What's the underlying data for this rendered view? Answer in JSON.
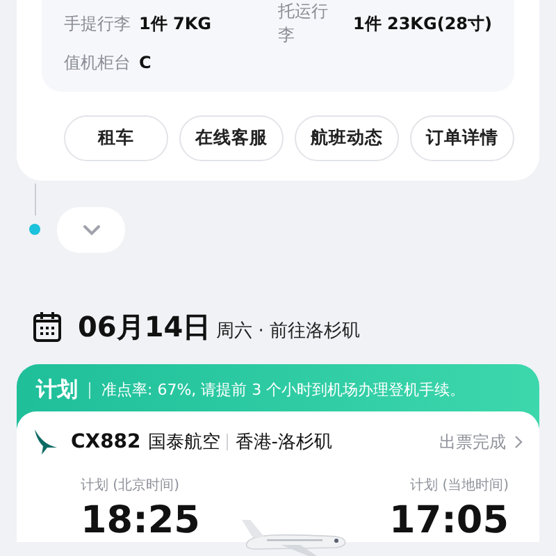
{
  "baggage": {
    "items": [
      {
        "label": "手提行李",
        "value": "1件 7KG"
      },
      {
        "label": "托运行李",
        "value": "1件 23KG(28寸)"
      },
      {
        "label": "值机柜台",
        "value": "C"
      }
    ]
  },
  "actions": [
    "租车",
    "在线客服",
    "航班动态",
    "订单详情"
  ],
  "date": {
    "day": "06月14日",
    "detail": "周六 · 前往洛杉矶"
  },
  "banner": {
    "status": "计划",
    "note": "准点率: 67%, 请提前 3 个小时到机场办理登机手续。"
  },
  "flight": {
    "number": "CX882",
    "airline": "国泰航空",
    "route": "香港-洛杉矶",
    "ticket_status": "出票完成",
    "departure": {
      "label": "计划 (北京时间)",
      "time": "18:25"
    },
    "arrival": {
      "label": "计划 (当地时间)",
      "time": "17:05"
    }
  }
}
